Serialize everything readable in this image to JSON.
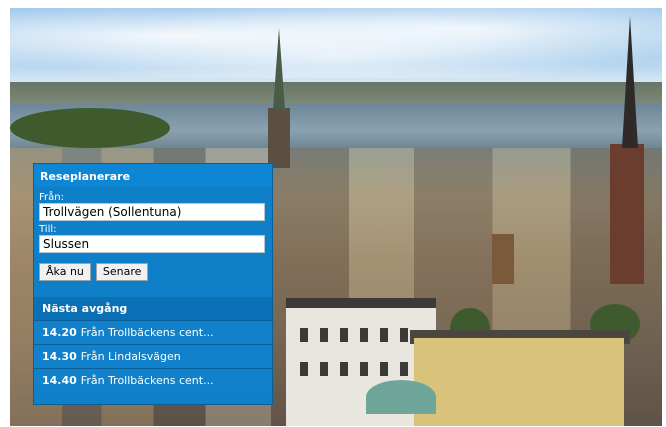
{
  "widget": {
    "title": "Reseplanerare",
    "from_label": "Från:",
    "from_value": "Trollvägen (Sollentuna)",
    "to_label": "Till:",
    "to_value": "Slussen",
    "buttons": {
      "now": "Åka nu",
      "later": "Senare"
    },
    "departures_title": "Nästa avgång",
    "departures": [
      {
        "time": "14.20",
        "label": "Från Trollbäckens cent..."
      },
      {
        "time": "14.30",
        "label": "Från Lindalsvägen"
      },
      {
        "time": "14.40",
        "label": "Från Trollbäckens cent..."
      }
    ]
  },
  "colors": {
    "widget_bg": "#0f7fc8",
    "header_bg": "#0f86d3",
    "departures_head_bg": "#0a6fb4"
  }
}
